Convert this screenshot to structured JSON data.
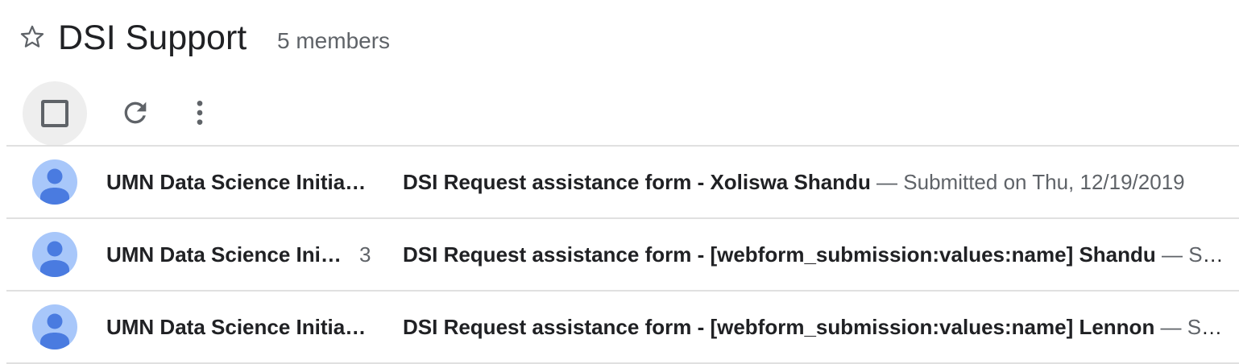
{
  "header": {
    "title": "DSI Support",
    "members": "5 members",
    "star_icon": "star-outline-icon"
  },
  "toolbar": {
    "select_icon": "checkbox-icon",
    "refresh_icon": "refresh-icon",
    "more_icon": "more-vert-icon"
  },
  "conversations": [
    {
      "sender": "UMN Data Science Initiative",
      "count": "",
      "subject": "DSI Request assistance form - Xoliswa Shandu",
      "snippet": " — Submitted on Thu, 12/19/2019"
    },
    {
      "sender": "UMN Data Science Initiative",
      "count": "3",
      "subject": "DSI Request assistance form - [webform_submission:values:name] Shandu",
      "snippet": " — Submitted"
    },
    {
      "sender": "UMN Data Science Initiative",
      "count": "",
      "subject": "DSI Request assistance form - [webform_submission:values:name] Lennon",
      "snippet": " — Submitted"
    }
  ],
  "colors": {
    "avatar_bg": "#a8c7fa",
    "avatar_fg": "#4a7be0",
    "text_primary": "#202124",
    "text_secondary": "#5f6368",
    "divider": "#e0e0e0"
  }
}
